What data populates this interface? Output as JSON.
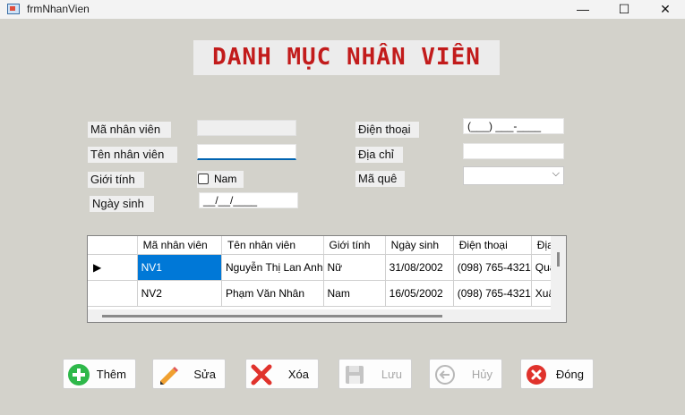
{
  "window": {
    "title": "frmNhanVien",
    "minimize": "—",
    "maximize": "☐",
    "close": "✕"
  },
  "heading": "DANH MỤC NHÂN VIÊN",
  "form": {
    "ma_nhan_vien": {
      "label": "Mã nhân viên",
      "value": ""
    },
    "ten_nhan_vien": {
      "label": "Tên nhân viên",
      "value": ""
    },
    "gioi_tinh": {
      "label": "Giới tính",
      "checkbox_label": "Nam",
      "checked": false
    },
    "ngay_sinh": {
      "label": "Ngày sinh",
      "value": "__/__/____"
    },
    "dien_thoai": {
      "label": "Điện thoại",
      "value": "(___) ___-____"
    },
    "dia_chi": {
      "label": "Địa chỉ",
      "value": ""
    },
    "ma_que": {
      "label": "Mã quê",
      "value": ""
    }
  },
  "grid": {
    "columns": [
      "Mã nhân viên",
      "Tên nhân viên",
      "Giới tính",
      "Ngày sinh",
      "Điện thoại",
      "Địa"
    ],
    "rows": [
      {
        "indicator": "▶",
        "cells": [
          "NV1",
          "Nguyễn Thị Lan Anh",
          "Nữ",
          "31/08/2002",
          "(098) 765-4321",
          "Quả"
        ]
      },
      {
        "indicator": "",
        "cells": [
          "NV2",
          "Phạm Văn Nhân",
          "Nam",
          "16/05/2002",
          "(098) 765-4321",
          "Xuâ"
        ]
      }
    ]
  },
  "buttons": {
    "them": {
      "label": "Thêm",
      "icon": "plus-circle-icon",
      "color": "#2eb84a"
    },
    "sua": {
      "label": "Sửa",
      "icon": "pencil-icon",
      "color": "#f0a030"
    },
    "xoa": {
      "label": "Xóa",
      "icon": "x-icon",
      "color": "#e0322c"
    },
    "luu": {
      "label": "Lưu",
      "icon": "floppy-disk-icon",
      "disabled": true
    },
    "huy": {
      "label": "Hủy",
      "icon": "arrow-left-icon",
      "disabled": true
    },
    "dong": {
      "label": "Đóng",
      "icon": "close-circle-icon",
      "color": "#e0322c"
    }
  },
  "colors": {
    "heading": "#c21b1b",
    "selection": "#0078d7",
    "form_bg": "#d3d2cb"
  }
}
